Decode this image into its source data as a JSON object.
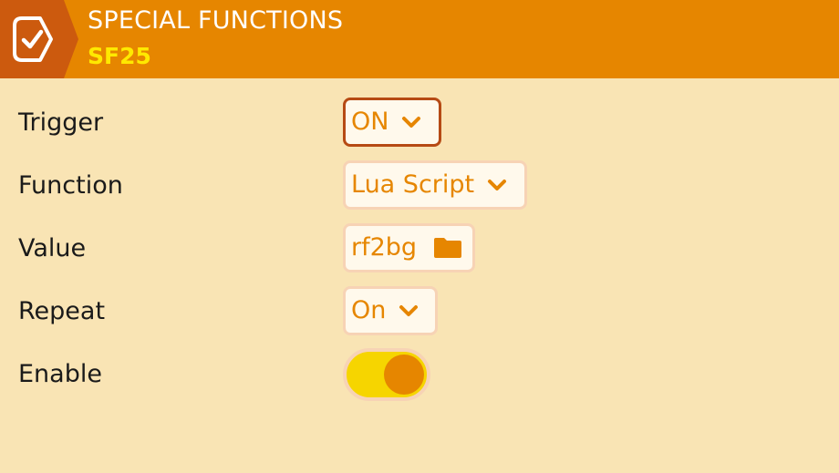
{
  "header": {
    "title": "SPECIAL FUNCTIONS",
    "subtitle": "SF25",
    "icon": "checkbox-icon"
  },
  "colors": {
    "accent": "#E68600",
    "background": "#F9E4B4",
    "subtitle": "#FFE900",
    "toggle_on": "#F6D500",
    "focus_border": "#B64A14"
  },
  "form": {
    "trigger": {
      "label": "Trigger",
      "value": "ON"
    },
    "function": {
      "label": "Function",
      "value": "Lua Script"
    },
    "value": {
      "label": "Value",
      "value": "rf2bg",
      "icon": "folder-icon"
    },
    "repeat": {
      "label": "Repeat",
      "value": "On"
    },
    "enable": {
      "label": "Enable",
      "checked": true
    }
  }
}
